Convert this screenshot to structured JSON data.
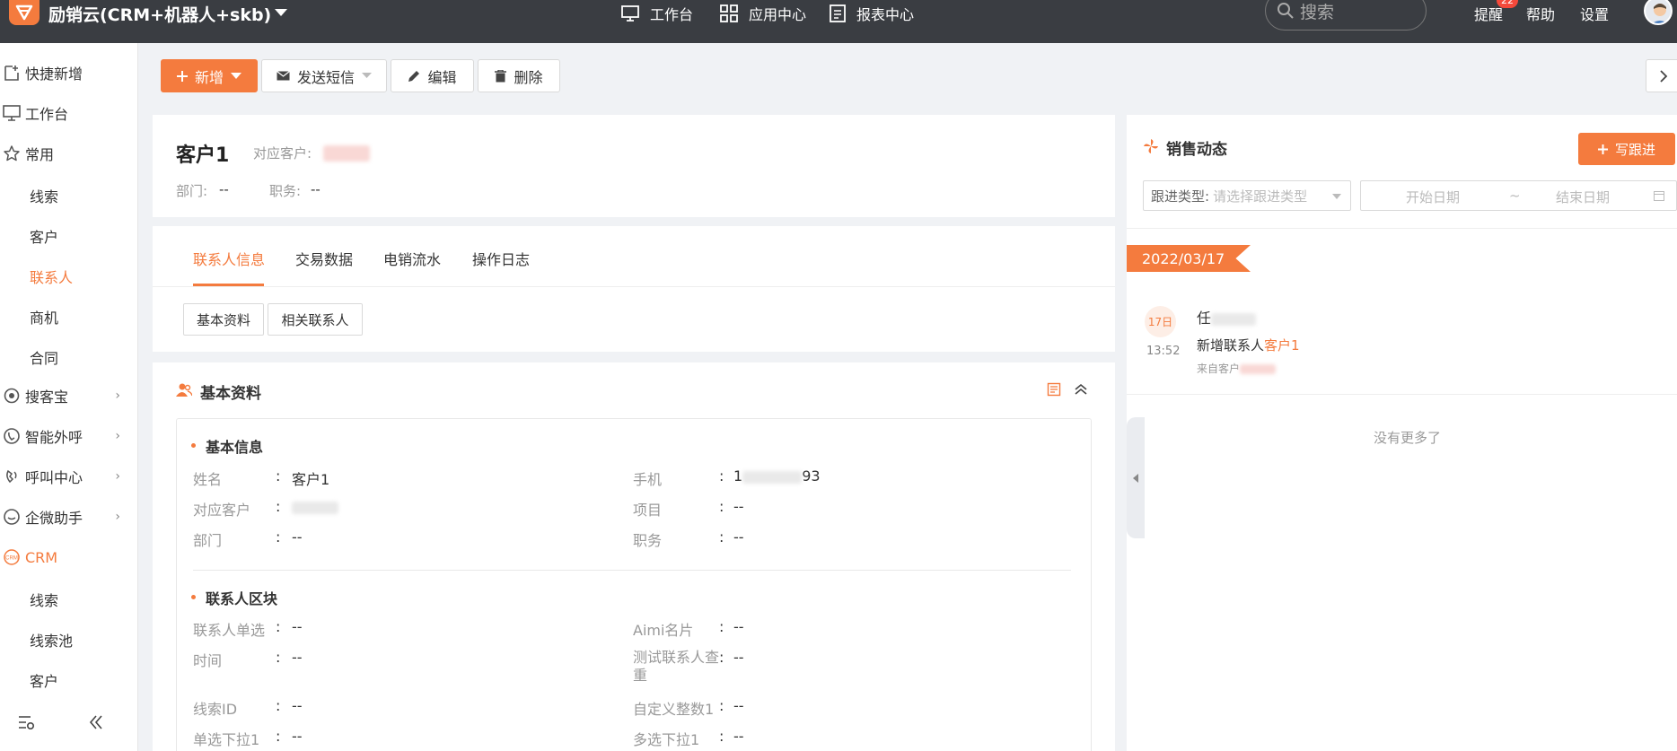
{
  "header": {
    "app_title": "励销云(CRM+机器人+skb)",
    "nav": [
      {
        "label": "工作台",
        "icon": "monitor-icon"
      },
      {
        "label": "应用中心",
        "icon": "grid-icon"
      },
      {
        "label": "报表中心",
        "icon": "report-icon"
      }
    ],
    "search_placeholder": "搜索",
    "reminder_label": "提醒",
    "reminder_count": "22",
    "help_label": "帮助",
    "settings_label": "设置"
  },
  "sidebar": {
    "quick_add": "快捷新增",
    "workbench": "工作台",
    "common": "常用",
    "common_items": [
      "线索",
      "客户",
      "联系人",
      "商机",
      "合同"
    ],
    "groups": [
      "搜客宝",
      "智能外呼",
      "呼叫中心",
      "企微助手"
    ],
    "crm": "CRM",
    "crm_items": [
      "线索",
      "线索池",
      "客户"
    ]
  },
  "toolbar": {
    "add": "新增",
    "send_sms": "发送短信",
    "edit": "编辑",
    "delete": "删除"
  },
  "contact": {
    "name": "客户1",
    "customer_label": "对应客户:",
    "dept_label": "部门:",
    "dept_value": "--",
    "title_label": "职务:",
    "title_value": "--"
  },
  "tabs": [
    "联系人信息",
    "交易数据",
    "电销流水",
    "操作日志"
  ],
  "subtabs": [
    "基本资料",
    "相关联系人"
  ],
  "basic": {
    "section_title": "基本资料",
    "info_title": "基本信息",
    "fields": [
      {
        "label": "姓名",
        "value": "客户1"
      },
      {
        "label": "手机",
        "value_prefix": "1",
        "value_suffix": "93"
      },
      {
        "label": "对应客户",
        "value": ""
      },
      {
        "label": "项目",
        "value": "--"
      },
      {
        "label": "部门",
        "value": "--"
      },
      {
        "label": "职务",
        "value": "--"
      }
    ],
    "block_title": "联系人区块",
    "block_fields": [
      {
        "label": "联系人单选",
        "value": "--"
      },
      {
        "label": "Aimi名片",
        "value": "--"
      },
      {
        "label": "时间",
        "value": "--"
      },
      {
        "label": "测试联系人查重",
        "value": "--"
      },
      {
        "label": "线索ID",
        "value": "--"
      },
      {
        "label": "自定义整数1",
        "value": "--"
      },
      {
        "label": "单选下拉1",
        "value": "--"
      },
      {
        "label": "多选下拉1",
        "value": "--"
      }
    ]
  },
  "sales": {
    "title": "销售动态",
    "write_button": "写跟进",
    "filter_label": "跟进类型:",
    "filter_placeholder": "请选择跟进类型",
    "start_date": "开始日期",
    "date_sep": "~",
    "end_date": "结束日期",
    "date_tag": "2022/03/17",
    "entry_day": "17日",
    "entry_time": "13:52",
    "entry_user": "任",
    "entry_text": "新增联系人",
    "entry_link": "客户1",
    "entry_source": "来自客户",
    "no_more": "没有更多了"
  },
  "colors": {
    "accent": "#f47b3e",
    "topbar": "#3a3d42"
  }
}
